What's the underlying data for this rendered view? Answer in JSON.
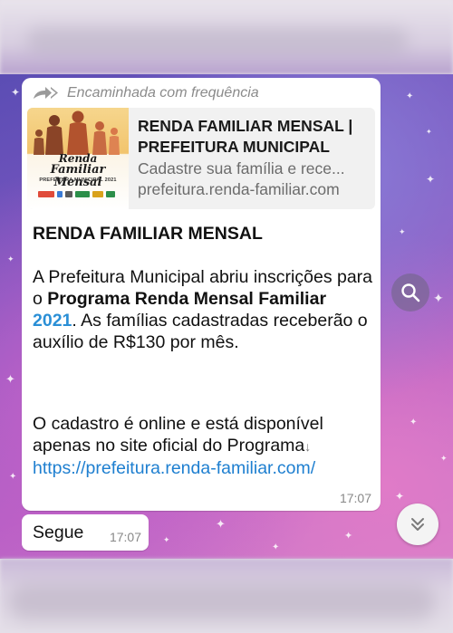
{
  "chat": {
    "forwarded_label": "Encaminhada com frequência",
    "link_preview": {
      "title": "RENDA FAMILIAR MENSAL | PREFEITURA MUNICIPAL",
      "description": "Cadastre sua família e rece...",
      "domain": "prefeitura.renda-familiar.com",
      "thumbnail": {
        "line1": "Renda",
        "line2": "Familiar Mensal",
        "line3": "PREFEITURA MUNICIPAL 2021"
      }
    },
    "message": {
      "title": "RENDA FAMILIAR MENSAL",
      "p1_a": "A Prefeitura Municipal abriu inscrições para o ",
      "p1_bold": "Programa Renda Mensal Familiar",
      "p1_space": " ",
      "p1_year": "2021",
      "p1_b": ". As famílias cadastradas receberão o auxílio de R$130 por mês.",
      "p2_text": "O cadastro é online e está disponível apenas no site oficial do Programa",
      "p2_link": "https://prefeitura.renda-familiar.com/",
      "time": "17:07"
    },
    "reply": {
      "text": "Segue",
      "time": "17:07"
    }
  },
  "icons": {
    "forward": "forward-double-arrow-icon",
    "search": "search-icon",
    "scroll_down": "chevron-double-down-icon"
  },
  "colors": {
    "link": "#1e7fd0",
    "year_highlight": "#2a8fd6",
    "bubble": "#ffffff"
  }
}
